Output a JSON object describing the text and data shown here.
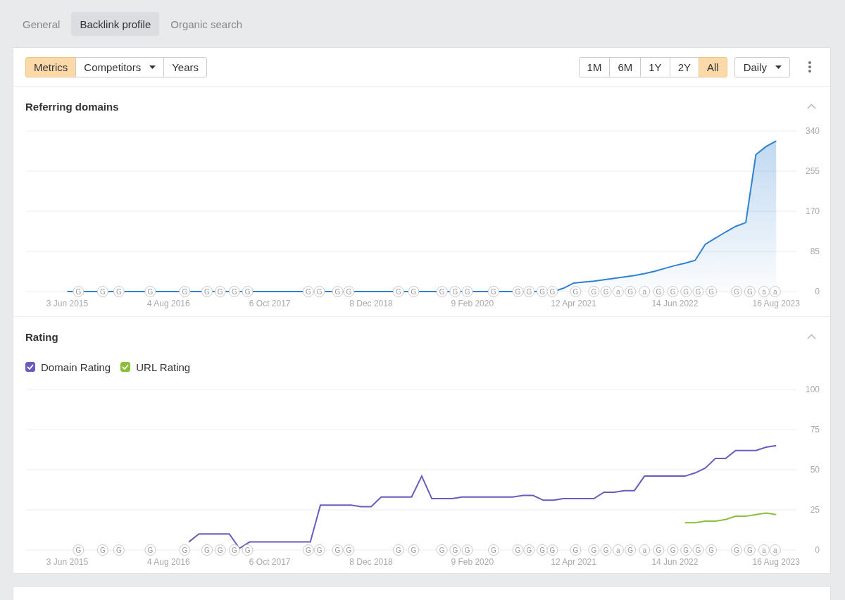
{
  "tabs": [
    {
      "label": "General",
      "selected": false
    },
    {
      "label": "Backlink profile",
      "selected": true
    },
    {
      "label": "Organic search",
      "selected": false
    }
  ],
  "toolbar": {
    "view_modes": [
      {
        "label": "Metrics",
        "selected": true,
        "kind": "button"
      },
      {
        "label": "Competitors",
        "selected": false,
        "kind": "dropdown"
      },
      {
        "label": "Years",
        "selected": false,
        "kind": "button"
      }
    ],
    "ranges": [
      {
        "label": "1M",
        "selected": false
      },
      {
        "label": "6M",
        "selected": false
      },
      {
        "label": "1Y",
        "selected": false
      },
      {
        "label": "2Y",
        "selected": false
      },
      {
        "label": "All",
        "selected": true
      }
    ],
    "interval": {
      "label": "Daily"
    }
  },
  "sections": [
    {
      "expanded": true,
      "chart_data": {
        "type": "area",
        "categories": [
          null,
          null,
          null,
          null,
          "3 Jun 2015",
          null,
          null,
          null,
          null,
          null,
          null,
          null,
          null,
          null,
          "4 Aug 2016",
          null,
          null,
          null,
          null,
          null,
          null,
          null,
          null,
          null,
          "6 Oct 2017",
          null,
          null,
          null,
          null,
          null,
          null,
          null,
          null,
          null,
          "8 Dec 2018",
          null,
          null,
          null,
          null,
          null,
          null,
          null,
          null,
          null,
          "9 Feb 2020",
          null,
          null,
          null,
          null,
          null,
          null,
          null,
          null,
          null,
          "12 Apr 2021",
          null,
          null,
          null,
          null,
          null,
          null,
          null,
          null,
          null,
          "14 Jun 2022",
          null,
          null,
          null,
          null,
          null,
          null,
          null,
          null,
          null,
          "16 Aug 2023",
          null,
          null
        ],
        "series": [
          {
            "name": "Referring domains",
            "color": "#2f80d1",
            "values": [
              null,
              null,
              null,
              null,
              0,
              0,
              0,
              0,
              0,
              0,
              0,
              0,
              0,
              0,
              0,
              0,
              0,
              0,
              0,
              0,
              0,
              0,
              0,
              0,
              0,
              0,
              0,
              0,
              0,
              0,
              0,
              0,
              0,
              0,
              0,
              0,
              0,
              0,
              0,
              0,
              0,
              0,
              0,
              0,
              0,
              0,
              0,
              0,
              0,
              0,
              0,
              0,
              0,
              7,
              18,
              20,
              22,
              25,
              28,
              31,
              34,
              38,
              43,
              49,
              55,
              60,
              66,
              100,
              113,
              126,
              138,
              146,
              290,
              307,
              319,
              null,
              null
            ]
          }
        ],
        "grid": true,
        "ylim": [
          0,
          340
        ],
        "yticks": [
          0,
          85,
          170,
          255,
          340
        ]
      },
      "markers": [
        {
          "text": "G"
        },
        {
          "text": "G"
        },
        {
          "text": "G"
        },
        {
          "text": "G"
        },
        {
          "text": "G"
        },
        {
          "text": "G"
        },
        {
          "text": "G"
        },
        {
          "text": "G"
        },
        {
          "text": "G"
        },
        {
          "text": "G"
        },
        {
          "text": "G"
        },
        {
          "text": "G"
        },
        {
          "text": "G"
        },
        {
          "text": "G"
        },
        {
          "text": "G"
        },
        {
          "text": "G"
        },
        {
          "text": "G"
        },
        {
          "text": "G"
        },
        {
          "text": "G"
        },
        {
          "text": "G"
        },
        {
          "text": "G"
        },
        {
          "text": "G"
        },
        {
          "text": "G"
        },
        {
          "text": "G"
        },
        {
          "text": "G"
        },
        {
          "text": "G"
        },
        {
          "text": "a"
        },
        {
          "text": "G"
        },
        {
          "text": "a"
        },
        {
          "text": "G"
        },
        {
          "text": "G"
        },
        {
          "text": "G"
        },
        {
          "text": "G"
        },
        {
          "text": "G"
        },
        {
          "text": "G"
        },
        {
          "text": "G"
        },
        {
          "text": "a"
        },
        {
          "text": "a"
        }
      ]
    },
    {
      "expanded": true,
      "legend": [
        {
          "checked": true
        },
        {
          "checked": true
        }
      ],
      "chart_data": {
        "type": "line",
        "title": "Rating",
        "categories": [
          null,
          null,
          null,
          null,
          "3 Jun 2015",
          null,
          null,
          null,
          null,
          null,
          null,
          null,
          null,
          null,
          "4 Aug 2016",
          null,
          null,
          null,
          null,
          null,
          null,
          null,
          null,
          null,
          "6 Oct 2017",
          null,
          null,
          null,
          null,
          null,
          null,
          null,
          null,
          null,
          "8 Dec 2018",
          null,
          null,
          null,
          null,
          null,
          null,
          null,
          null,
          null,
          "9 Feb 2020",
          null,
          null,
          null,
          null,
          null,
          null,
          null,
          null,
          null,
          "12 Apr 2021",
          null,
          null,
          null,
          null,
          null,
          null,
          null,
          null,
          null,
          "14 Jun 2022",
          null,
          null,
          null,
          null,
          null,
          null,
          null,
          null,
          null,
          "16 Aug 2023",
          null,
          null
        ],
        "series": [
          {
            "name": "Domain Rating",
            "color": "#6a5bbd",
            "values": [
              null,
              null,
              null,
              null,
              null,
              null,
              null,
              null,
              null,
              null,
              null,
              null,
              null,
              null,
              null,
              null,
              5,
              10,
              10,
              10,
              10,
              1,
              5,
              5,
              5,
              5,
              5,
              5,
              5,
              28,
              28,
              28,
              28,
              27,
              27,
              33,
              33,
              33,
              33,
              46,
              32,
              32,
              32,
              33,
              33,
              33,
              33,
              33,
              33,
              34,
              34,
              31,
              31,
              32,
              32,
              32,
              32,
              36,
              36,
              37,
              37,
              46,
              46,
              46,
              46,
              46,
              48,
              51,
              57,
              57,
              62,
              62,
              62,
              64,
              65,
              null,
              null
            ]
          },
          {
            "name": "URL Rating",
            "color": "#8bbf3a",
            "values": [
              null,
              null,
              null,
              null,
              null,
              null,
              null,
              null,
              null,
              null,
              null,
              null,
              null,
              null,
              null,
              null,
              null,
              null,
              null,
              null,
              null,
              null,
              null,
              null,
              null,
              null,
              null,
              null,
              null,
              null,
              null,
              null,
              null,
              null,
              null,
              null,
              null,
              null,
              null,
              null,
              null,
              null,
              null,
              null,
              null,
              null,
              null,
              null,
              null,
              null,
              null,
              null,
              null,
              null,
              null,
              null,
              null,
              null,
              null,
              null,
              null,
              null,
              null,
              null,
              null,
              17,
              17,
              18,
              18,
              19,
              21,
              21,
              22,
              23,
              22,
              null,
              null
            ]
          }
        ],
        "grid": true,
        "ylim": [
          0,
          100
        ],
        "yticks": [
          0,
          25,
          50,
          75,
          100
        ]
      },
      "markers": [
        {
          "text": "G"
        },
        {
          "text": "G"
        },
        {
          "text": "G"
        },
        {
          "text": "G"
        },
        {
          "text": "G"
        },
        {
          "text": "G"
        },
        {
          "text": "G"
        },
        {
          "text": "G"
        },
        {
          "text": "G"
        },
        {
          "text": "G"
        },
        {
          "text": "G"
        },
        {
          "text": "G"
        },
        {
          "text": "G"
        },
        {
          "text": "G"
        },
        {
          "text": "G"
        },
        {
          "text": "G"
        },
        {
          "text": "G"
        },
        {
          "text": "G"
        },
        {
          "text": "G"
        },
        {
          "text": "G"
        },
        {
          "text": "G"
        },
        {
          "text": "G"
        },
        {
          "text": "G"
        },
        {
          "text": "G"
        },
        {
          "text": "G"
        },
        {
          "text": "G"
        },
        {
          "text": "a"
        },
        {
          "text": "G"
        },
        {
          "text": "a"
        },
        {
          "text": "G"
        },
        {
          "text": "G"
        },
        {
          "text": "G"
        },
        {
          "text": "G"
        },
        {
          "text": "G"
        },
        {
          "text": "G"
        },
        {
          "text": "G"
        },
        {
          "text": "a"
        },
        {
          "text": "a"
        }
      ]
    }
  ]
}
